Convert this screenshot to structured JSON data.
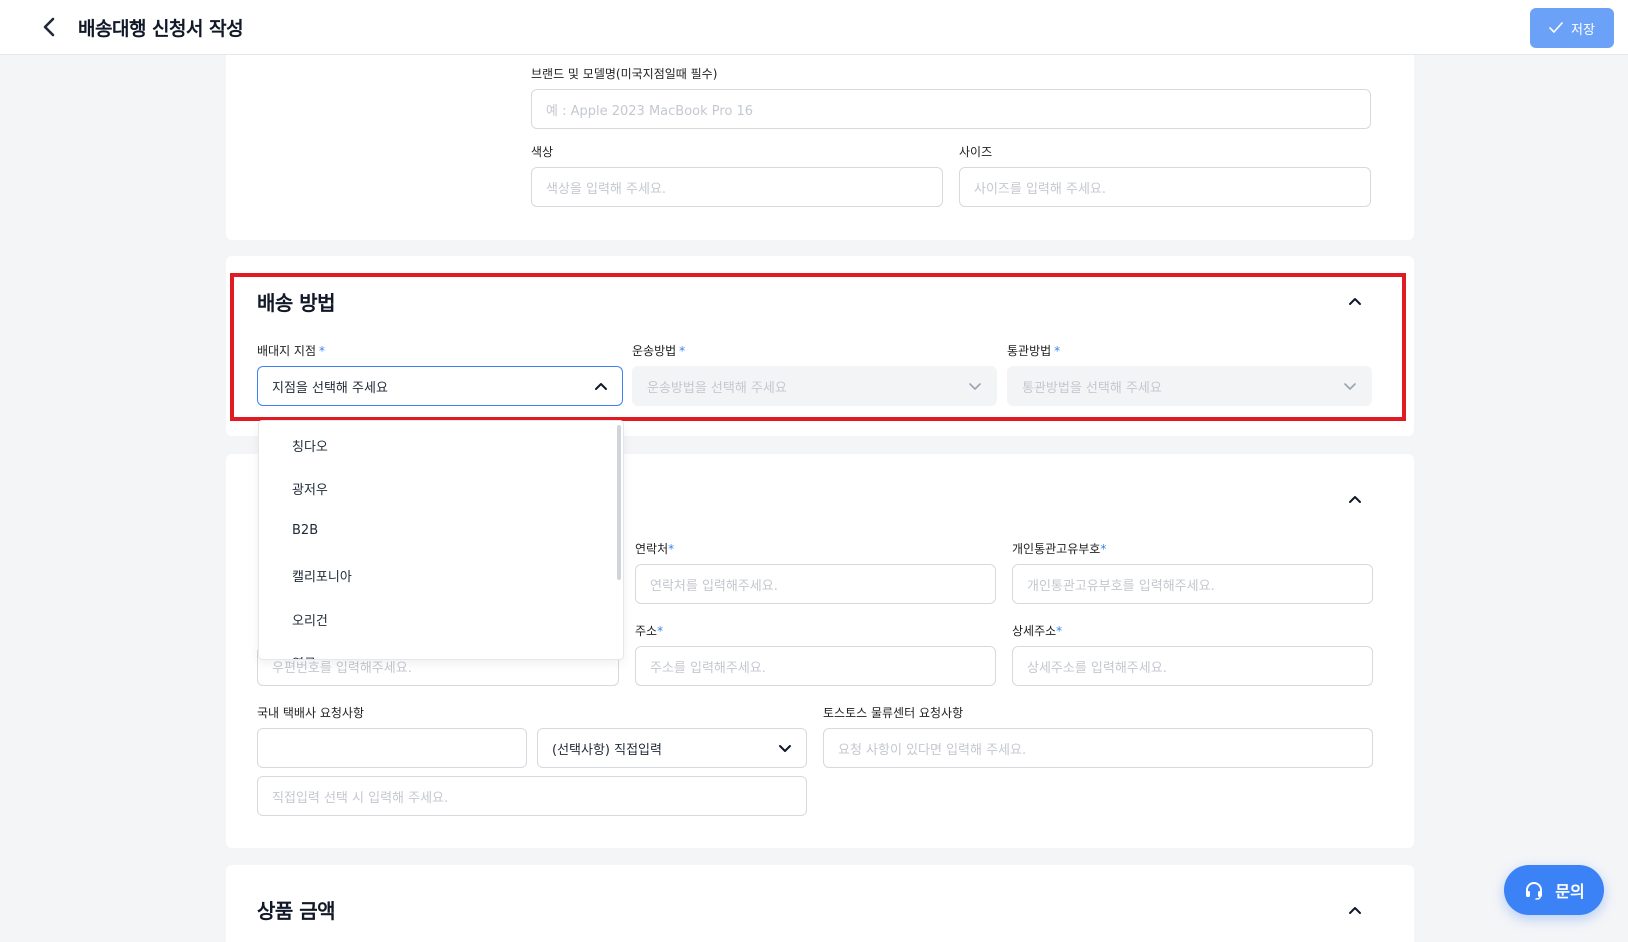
{
  "header": {
    "title": "배송대행 신청서 작성",
    "save_label": "저장"
  },
  "product_info": {
    "brand_label": "브랜드 및 모델명(미국지점일때 필수)",
    "brand_placeholder": "예 : Apple 2023 MacBook Pro 16",
    "color_label": "색상",
    "color_placeholder": "색상을 입력해 주세요.",
    "size_label": "사이즈",
    "size_placeholder": "사이즈를 입력해 주세요."
  },
  "shipping_method": {
    "title": "배송 방법",
    "branch_label": "배대지 지점",
    "branch_placeholder": "지점을 선택해 주세요",
    "transport_label": "운송방법",
    "transport_placeholder": "운송방법을 선택해 주세요",
    "customs_label": "통관방법",
    "customs_placeholder": "통관방법을 선택해 주세요",
    "required_mark": "*",
    "branch_options": [
      "칭다오",
      "광저우",
      "B2B",
      "캘리포니아",
      "오리건",
      "영국"
    ]
  },
  "recipient": {
    "contact_label": "연락처",
    "contact_placeholder": "연락처를 입력해주세요.",
    "pccc_label": "개인통관고유부호",
    "pccc_placeholder": "개인통관고유부호를 입력해주세요.",
    "zip_placeholder": "우편번호를 입력해주세요.",
    "address_label": "주소",
    "address_placeholder": "주소를 입력해주세요.",
    "detail_address_label": "상세주소",
    "detail_address_placeholder": "상세주소를 입력해주세요.",
    "required_mark": "*",
    "courier_request_label": "국내 택배사 요청사항",
    "courier_request_select": "(선택사항) 직접입력",
    "courier_request_direct_placeholder": "직접입력 선택 시 입력해 주세요.",
    "center_request_label": "토스토스 물류센터 요청사항",
    "center_request_placeholder": "요청 사항이 있다면 입력해 주세요."
  },
  "price_section": {
    "title": "상품 금액"
  },
  "chat": {
    "label": "문의"
  },
  "colors": {
    "accent": "#3b82f6",
    "highlight": "#e01b24"
  }
}
